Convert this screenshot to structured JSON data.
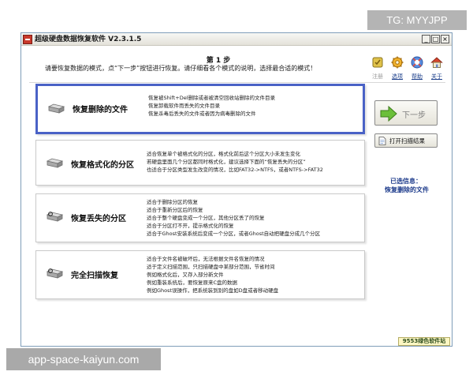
{
  "watermarks": {
    "top": "TG: MYYJPP",
    "bottom": "app-space-kaiyun.com"
  },
  "window": {
    "title": "超级硬盘数据恢复软件 V2.3.1.5",
    "buttons": [
      "_",
      "□",
      "×"
    ]
  },
  "header": {
    "step_title": "第 1 步",
    "description": "请要恢复数据的模式，点“下一步”按钮进行恢复。请仔细看各个模式的说明，选择最合适的模式！"
  },
  "toolbar": [
    {
      "label": "注册",
      "icon": "register-icon",
      "disabled": true
    },
    {
      "label": "选项",
      "icon": "options-gear-icon",
      "disabled": false
    },
    {
      "label": "帮助",
      "icon": "help-icon",
      "disabled": false
    },
    {
      "label": "关于",
      "icon": "about-home-icon",
      "disabled": false
    }
  ],
  "options": [
    {
      "name": "恢复删除的文件",
      "selected": true,
      "description": [
        "恢复被Shift+Del删除或者被清空回收站删除的文件目录",
        "恢复卸载软件而丢失的文件目录",
        "恢复杀毒后丢失的文件或者因为病毒删除的文件"
      ]
    },
    {
      "name": "恢复格式化的分区",
      "selected": false,
      "description": [
        "适合恢复单个被格式化的分区，格式化前后这个分区大小未发生变化",
        "若硬盘里面几个分区都同时格式化，建议选择下面的“恢复丢失的分区”",
        "也适合于分区类型发生改变的情况，比如FAT32->NTFS，或者NTFS->FAT32"
      ]
    },
    {
      "name": "恢复丢失的分区",
      "selected": false,
      "description": [
        "适合于删除分区的恢复",
        "适合于重新分区后的恢复",
        "适合于整个硬盘变成一个分区，其他分区丢了的恢复",
        "适合于分区打不开，提示格式化的恢复",
        "适合于Ghost安装系统后变成一个分区，或者Ghost自动把硬盘分成几个分区"
      ]
    },
    {
      "name": "完全扫描恢复",
      "selected": false,
      "description": [
        "适合于文件名被破坏后，无法根据文件名恢复的情况",
        "适于定义扫描范围，只扫描硬盘中某部分范围，节省时间",
        "例如格式化后，又存入部分新文件",
        "例如重装系统后，要恢复原来C盘的数据",
        "例如Ghost误操作，把系统装到别的盘如D盘或者移动硬盘"
      ]
    }
  ],
  "actions": {
    "next_label": "下一步",
    "open_scan_label": "打开扫描结果"
  },
  "selection_info": {
    "title": "已选信息：",
    "value": "恢复删除的文件"
  },
  "site_badge": "9553绿色软件站",
  "colors": {
    "selected_border": "#4a62c6",
    "info_text": "#1e3c8c",
    "next_arrow": "#6bbf3a"
  }
}
